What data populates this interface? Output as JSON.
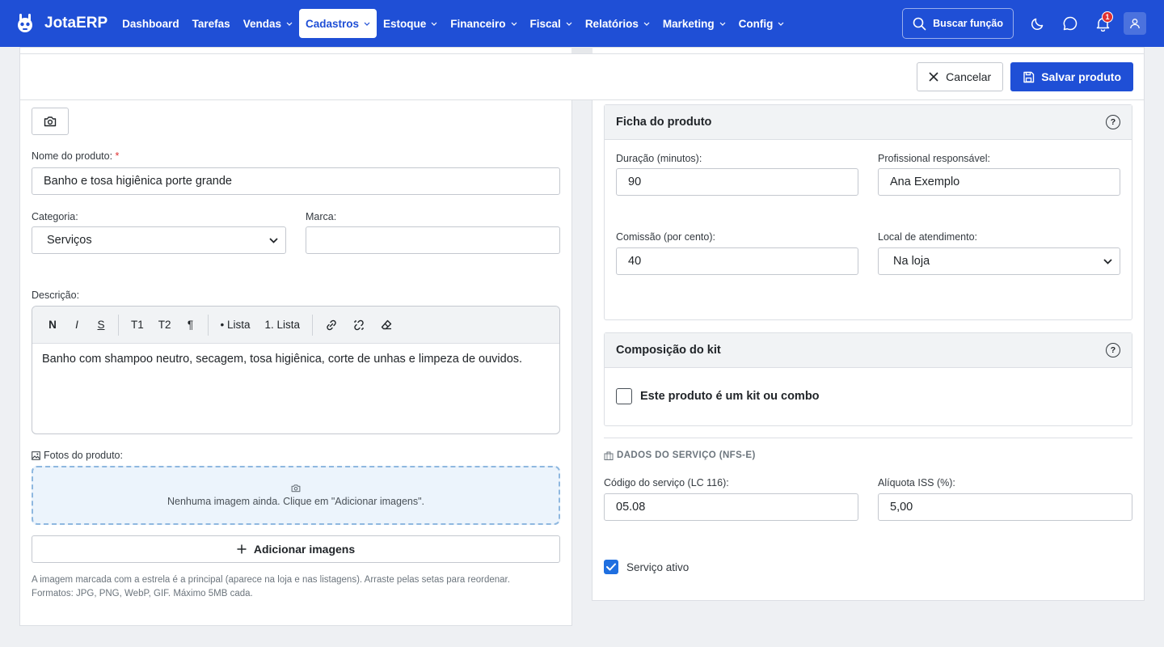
{
  "app": {
    "brand": "JotaERP"
  },
  "nav": {
    "items": [
      {
        "label": "Dashboard",
        "dropdown": false,
        "active": false
      },
      {
        "label": "Tarefas",
        "dropdown": false,
        "active": false
      },
      {
        "label": "Vendas",
        "dropdown": true,
        "active": false
      },
      {
        "label": "Cadastros",
        "dropdown": true,
        "active": true
      },
      {
        "label": "Estoque",
        "dropdown": true,
        "active": false
      },
      {
        "label": "Financeiro",
        "dropdown": true,
        "active": false
      },
      {
        "label": "Fiscal",
        "dropdown": true,
        "active": false
      },
      {
        "label": "Relatórios",
        "dropdown": true,
        "active": false
      },
      {
        "label": "Marketing",
        "dropdown": true,
        "active": false
      },
      {
        "label": "Config",
        "dropdown": true,
        "active": false
      }
    ],
    "search_label": "Buscar função",
    "notification_count": "1"
  },
  "actions": {
    "cancel_label": "Cancelar",
    "save_label": "Salvar produto"
  },
  "form": {
    "name_label": "Nome do produto:",
    "required_mark": "*",
    "name_value": "Banho e tosa higiênica porte grande",
    "category_label": "Categoria:",
    "category_value": "Serviços",
    "brand_label": "Marca:",
    "brand_value": "",
    "description_label": "Descrição:",
    "toolbar": {
      "bold": "N",
      "italic": "I",
      "strike": "S",
      "h1": "T1",
      "h2": "T2",
      "paragraph": "¶",
      "bullet_list": "• Lista",
      "ordered_list": "1. Lista"
    },
    "description_value": "Banho com shampoo neutro, secagem, tosa higiênica, corte de unhas e limpeza de ouvidos.",
    "photos_label": "Fotos do produto:",
    "dropzone_text": "Nenhuma imagem ainda. Clique em \"Adicionar imagens\".",
    "add_images_label": "Adicionar imagens",
    "help_line1": "A imagem marcada com a estrela é a principal (aparece na loja e nas listagens). Arraste pelas setas para reordenar.",
    "help_line2": "Formatos: JPG, PNG, WebP, GIF. Máximo 5MB cada."
  },
  "ficha": {
    "title": "Ficha do produto",
    "help": "?",
    "duration_label": "Duração (minutos):",
    "duration_value": "90",
    "professional_label": "Profissional responsável:",
    "professional_value": "Ana Exemplo",
    "commission_label": "Comissão (por cento):",
    "commission_value": "40",
    "location_label": "Local de atendimento:",
    "location_value": "Na loja"
  },
  "kit": {
    "title": "Composição do kit",
    "help": "?",
    "checkbox_label": "Este produto é um kit ou combo",
    "checked": false
  },
  "service": {
    "section_title": "DADOS DO SERVIÇO (NFS-E)",
    "code_label": "Código do serviço (LC 116):",
    "code_value": "05.08",
    "iss_label": "Alíquota ISS (%):",
    "iss_value": "5,00",
    "active_label": "Serviço ativo",
    "active": true
  }
}
